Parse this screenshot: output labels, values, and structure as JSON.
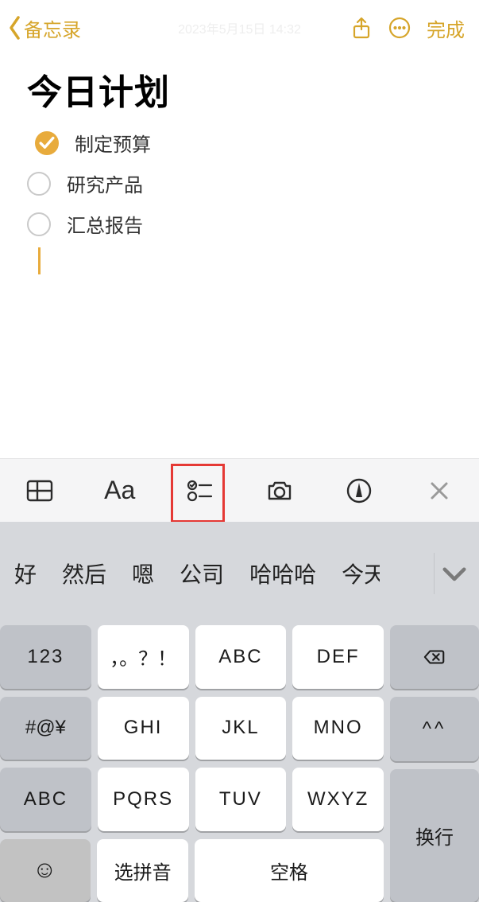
{
  "header": {
    "back_label": "备忘录",
    "timestamp": "2023年5月15日 14:32",
    "done_label": "完成"
  },
  "note": {
    "title": "今日计划",
    "items": [
      {
        "text": "制定预算",
        "checked": true
      },
      {
        "text": "研究产品",
        "checked": false
      },
      {
        "text": "汇总报告",
        "checked": false
      }
    ]
  },
  "format_bar": {
    "aa_label": "Aa"
  },
  "keyboard": {
    "suggestions": [
      "好",
      "然后",
      "嗯",
      "公司",
      "哈哈哈",
      "今天"
    ],
    "keys": {
      "num": "123",
      "punct": "，。？！",
      "abc": "ABC",
      "def": "DEF",
      "sym": "#@¥",
      "ghi": "GHI",
      "jkl": "JKL",
      "mno": "MNO",
      "face": "^^",
      "shift": "ABC",
      "pqrs": "PQRS",
      "tuv": "TUV",
      "wxyz": "WXYZ",
      "pinyin": "选拼音",
      "space": "空格",
      "enter": "换行"
    }
  }
}
